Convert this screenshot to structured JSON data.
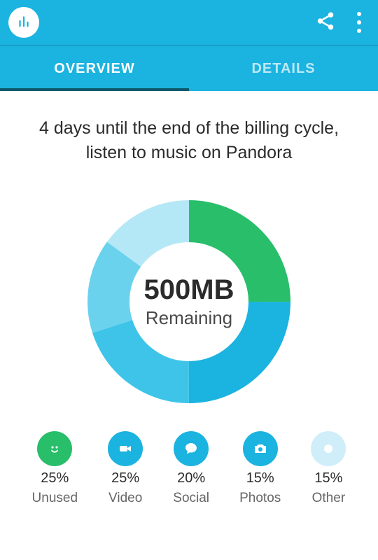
{
  "toolbar": {
    "app_icon": "bar-chart-icon",
    "share_icon": "share-icon",
    "more_icon": "more-vertical-icon"
  },
  "tabs": [
    {
      "label": "OVERVIEW",
      "active": true
    },
    {
      "label": "DETAILS",
      "active": false
    }
  ],
  "message": "4 days until the end of the billing cycle, listen to music on Pandora",
  "donut": {
    "amount": "500MB",
    "label": "Remaining"
  },
  "legend": [
    {
      "percent": "25%",
      "label": "Unused",
      "color": "#28be6a",
      "icon": "smiley-icon"
    },
    {
      "percent": "25%",
      "label": "Video",
      "color": "#1bb3e0",
      "icon": "video-icon"
    },
    {
      "percent": "20%",
      "label": "Social",
      "color": "#1bb3e0",
      "icon": "chat-icon"
    },
    {
      "percent": "15%",
      "label": "Photos",
      "color": "#1bb3e0",
      "icon": "camera-icon"
    },
    {
      "percent": "15%",
      "label": "Other",
      "color": "#cfeefa",
      "icon": "other-icon"
    }
  ],
  "chart_data": {
    "type": "pie",
    "title": "",
    "categories": [
      "Unused",
      "Video",
      "Social",
      "Photos",
      "Other"
    ],
    "values": [
      25,
      25,
      20,
      15,
      15
    ],
    "series_colors": [
      "#28be6a",
      "#1bb3e0",
      "#3ec4e8",
      "#6bd2ed",
      "#b5e8f6"
    ],
    "center_label_value": "500MB",
    "center_label_text": "Remaining"
  },
  "colors": {
    "primary": "#1bb3e0",
    "green": "#28be6a",
    "tab_underline": "#0d5a6f"
  }
}
